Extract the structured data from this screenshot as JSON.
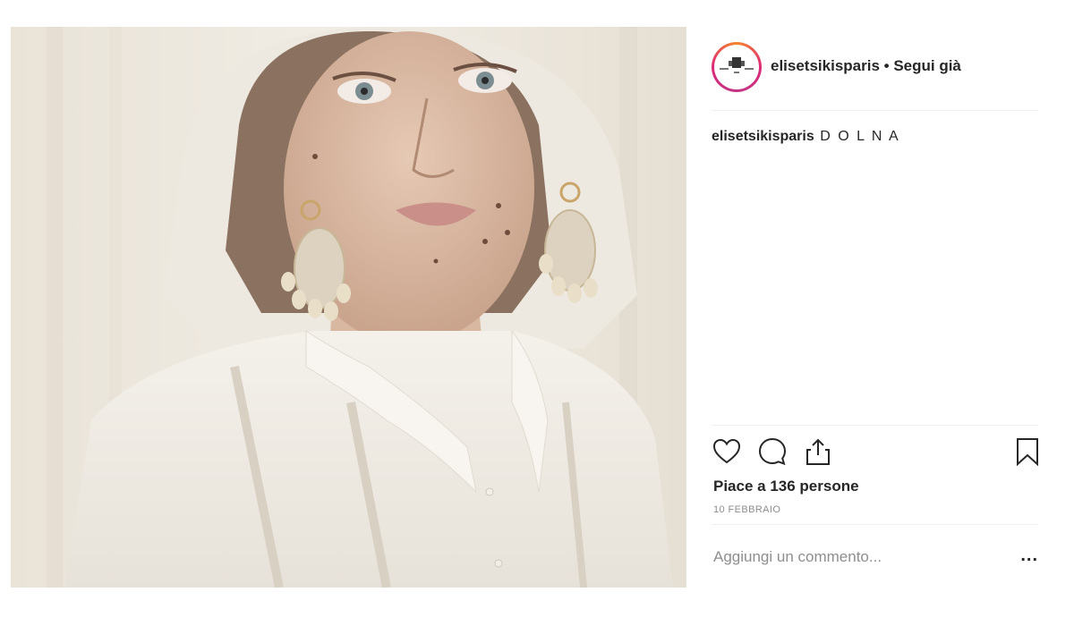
{
  "post": {
    "photo_alt": "",
    "username": "elisetsikisparis",
    "follow_status": " • Segui già",
    "caption_user": "elisetsikisparis",
    "caption_text": "D O L N A",
    "likes": "Piace a 136 persone",
    "date": "10 FEBBRAIO",
    "comment_placeholder": "Aggiungi un commento...",
    "more": "..."
  },
  "icons": {
    "like": "heart-outline-icon",
    "comment": "speech-bubble-icon",
    "share": "share-upload-icon",
    "save": "bookmark-outline-icon",
    "avatar": "brand-logo-icon"
  },
  "colors": {
    "text": "#262626",
    "muted": "#8e8e8e",
    "divider": "#efefef",
    "story_ring_start": "#f58529",
    "story_ring_end": "#dd2a7b"
  }
}
